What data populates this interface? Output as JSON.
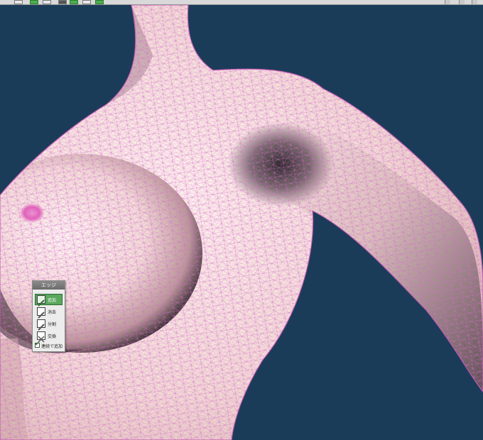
{
  "edge_panel": {
    "title": "エッジ",
    "tools": [
      {
        "label": "追加",
        "icon": "edge-add-icon",
        "active": true
      },
      {
        "label": "消去",
        "icon": "edge-delete-icon",
        "active": false
      },
      {
        "label": "分割",
        "icon": "edge-split-icon",
        "active": false
      },
      {
        "label": "交換",
        "icon": "edge-swap-icon",
        "active": false
      }
    ],
    "continuous_add": {
      "label": "連続で追加",
      "checked": true
    }
  },
  "colors": {
    "viewport_background": "#1b3c58",
    "mesh_wire": "#d36bc9",
    "skin": "#f3dcd5",
    "active_tool": "#5aa75e"
  }
}
